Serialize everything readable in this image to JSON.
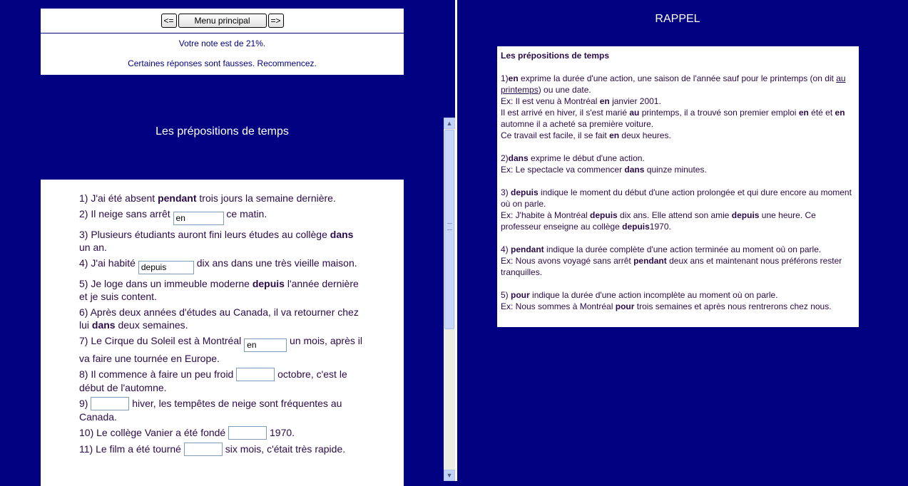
{
  "nav": {
    "prev_label": "<=",
    "menu_label": "Menu principal",
    "next_label": "=>",
    "score": "Votre note est de 21%.",
    "feedback": "Certaines réponses sont fausses. Recommencez."
  },
  "exercise": {
    "title": "Les prépositions de temps",
    "questions": [
      {
        "num": "1)",
        "before": "J'ai été absent ",
        "bold": "pendant",
        "after": " trois jours la semaine dernière."
      },
      {
        "num": "2)",
        "before": "Il neige sans arrêt ",
        "input": "en",
        "after": " ce matin."
      },
      {
        "num": "3)",
        "before": "Plusieurs étudiants auront fini leurs études au collège ",
        "bold": "dans",
        "after": " un an."
      },
      {
        "num": "4)",
        "before": "J'ai habité ",
        "input": "depuis",
        "after": " dix ans dans une très vieille maison."
      },
      {
        "num": "5)",
        "before": "Je loge dans un immeuble moderne ",
        "bold": "depuis",
        "after": " l'année dernière et je suis content."
      },
      {
        "num": "6)",
        "before": "Après deux années d'études au Canada, il va retourner chez lui ",
        "bold": "dans",
        "after": " deux semaines."
      },
      {
        "num": "7)",
        "before": "Le Cirque du Soleil est à Montréal ",
        "input": "en",
        "after": " un mois, après il va faire une tournée en Europe."
      },
      {
        "num": "8)",
        "before": "Il commence à faire un peu froid ",
        "input": "",
        "after": " octobre, c'est le début de l'automne."
      },
      {
        "num": "9)",
        "before": "",
        "input": "",
        "after": " hiver, les tempêtes de neige sont fréquentes au Canada."
      },
      {
        "num": "10)",
        "before": "Le collège Vanier a été fondé ",
        "input": "",
        "after": " 1970."
      },
      {
        "num": "11)",
        "before": "Le film a été tourné ",
        "input": "",
        "after": " six mois, c'était très rapide."
      }
    ]
  },
  "rappel": {
    "title": "RAPPEL",
    "heading": "Les prépositions de temps",
    "s1": {
      "num": "1)",
      "kw": "en",
      "l1a": " exprime la durée d'une action, une saison de l'année sauf pour le printemps (on dit ",
      "l1u": "au printemps",
      "l1b": ") ou une date.",
      "ex1a": "Ex: Il est venu à Montréal ",
      "ex1b": "en",
      "ex1c": " janvier 2001.",
      "ex2a": "Il est arrivé en hiver, il s'est marié ",
      "ex2b": "au",
      "ex2c": " printemps, il a trouvé son premier emploi ",
      "ex2d": "en",
      "ex2e": " été et ",
      "ex2f": "en",
      "ex2g": " automne il a acheté sa première voiture.",
      "ex3a": "Ce travail est facile, il se fait ",
      "ex3b": "en",
      "ex3c": " deux heures."
    },
    "s2": {
      "num": "2)",
      "kw": "dans",
      "l1": " exprime le début d'une action.",
      "exa": "Ex: Le spectacle va commencer ",
      "exb": "dans",
      "exc": " quinze minutes."
    },
    "s3": {
      "num": "3) ",
      "kw": "depuis",
      "l1": " indique le moment du début d'une action prolongée et qui dure encore au moment où on parle.",
      "exa": "Ex: J'habite à Montréal ",
      "exb": "depuis",
      "exc": " dix ans. Elle attend son amie ",
      "exd": "depuis",
      "exe": " une heure. Ce professeur enseigne au collège ",
      "exf": "depuis",
      "exg": "1970."
    },
    "s4": {
      "num": "4) ",
      "kw": "pendant",
      "l1": " indique la durée complète d'une action terminée au moment où on parle.",
      "exa": "Ex: Nous avons voyagé sans arrêt ",
      "exb": "pendant",
      "exc": " deux ans et maintenant nous préférons rester tranquilles."
    },
    "s5": {
      "num": "5) ",
      "kw": "pour",
      "l1": " indique la durée d'une action incomplète au moment où on parle.",
      "exa": "Ex: Nous sommes à Montréal ",
      "exb": "pour",
      "exc": " trois semaines et après nous rentrerons chez nous."
    }
  },
  "colors": {
    "background": "#000080",
    "text": "#2b0a4a",
    "panel": "#ffffff"
  },
  "icons": {
    "scroll_up": "chevron-up-icon",
    "scroll_down": "chevron-down-icon"
  }
}
